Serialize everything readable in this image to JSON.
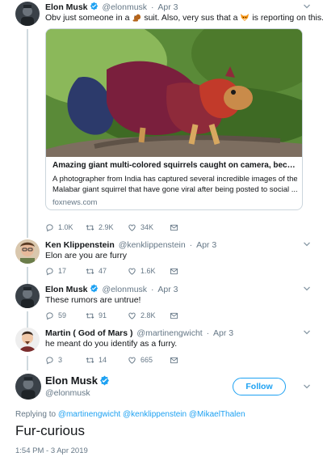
{
  "tweets": [
    {
      "name": "Elon Musk",
      "handle": "@elonmusk",
      "time": "Apr 3",
      "text_1": "Obv just someone in a",
      "emoji_1": "squirrel-emoji",
      "text_2": "suit. Also, very sus that a",
      "emoji_2": "fox-emoji",
      "text_3": "is reporting on this.",
      "card": {
        "title": "Amazing giant multi-colored squirrels caught on camera, become int...",
        "description_line1": "A photographer from India has captured several incredible images of the",
        "description_line2": "Malabar giant squirrel that have gone viral after being posted to social ...",
        "domain": "foxnews.com"
      },
      "replies": "1.0K",
      "retweets": "2.9K",
      "likes": "34K"
    },
    {
      "name": "Ken Klippenstein",
      "handle": "@kenklippenstein",
      "time": "Apr 3",
      "text": "Elon are you are furry",
      "replies": "17",
      "retweets": "47",
      "likes": "1.6K"
    },
    {
      "name": "Elon Musk",
      "handle": "@elonmusk",
      "time": "Apr 3",
      "text": "These rumors are untrue!",
      "replies": "59",
      "retweets": "91",
      "likes": "2.8K"
    },
    {
      "name": "Martin ( God of Mars )",
      "handle": "@martinengwicht",
      "time": "Apr 3",
      "text": "he meant do you identify as a furry.",
      "replies": "3",
      "retweets": "14",
      "likes": "665"
    }
  ],
  "main": {
    "name": "Elon Musk",
    "handle": "@elonmusk",
    "follow_label": "Follow",
    "replying_prefix": "Replying to",
    "replying_to": [
      "@martinengwicht",
      "@kenklippenstein",
      "@MikaelThalen"
    ],
    "text": "Fur-curious",
    "timestamp": "1:54 PM - 3 Apr 2019"
  },
  "colors": {
    "link": "#1da1f2",
    "secondary": "#657786",
    "verified": "#1da1f2",
    "border": "#ccd6dd"
  }
}
